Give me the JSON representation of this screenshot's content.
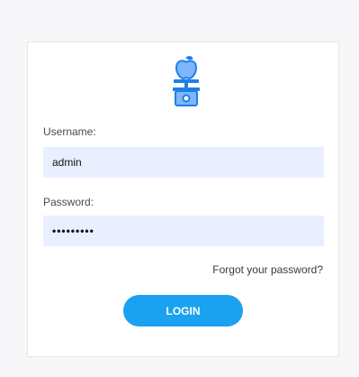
{
  "form": {
    "logo_icon": "apple-scale-icon",
    "accent_color": "#1aa1f0",
    "username": {
      "label": "Username:",
      "value": "admin"
    },
    "password": {
      "label": "Password:",
      "value": "•••••••••"
    },
    "forgot_password_label": "Forgot your password?",
    "login_label": "LOGIN"
  }
}
